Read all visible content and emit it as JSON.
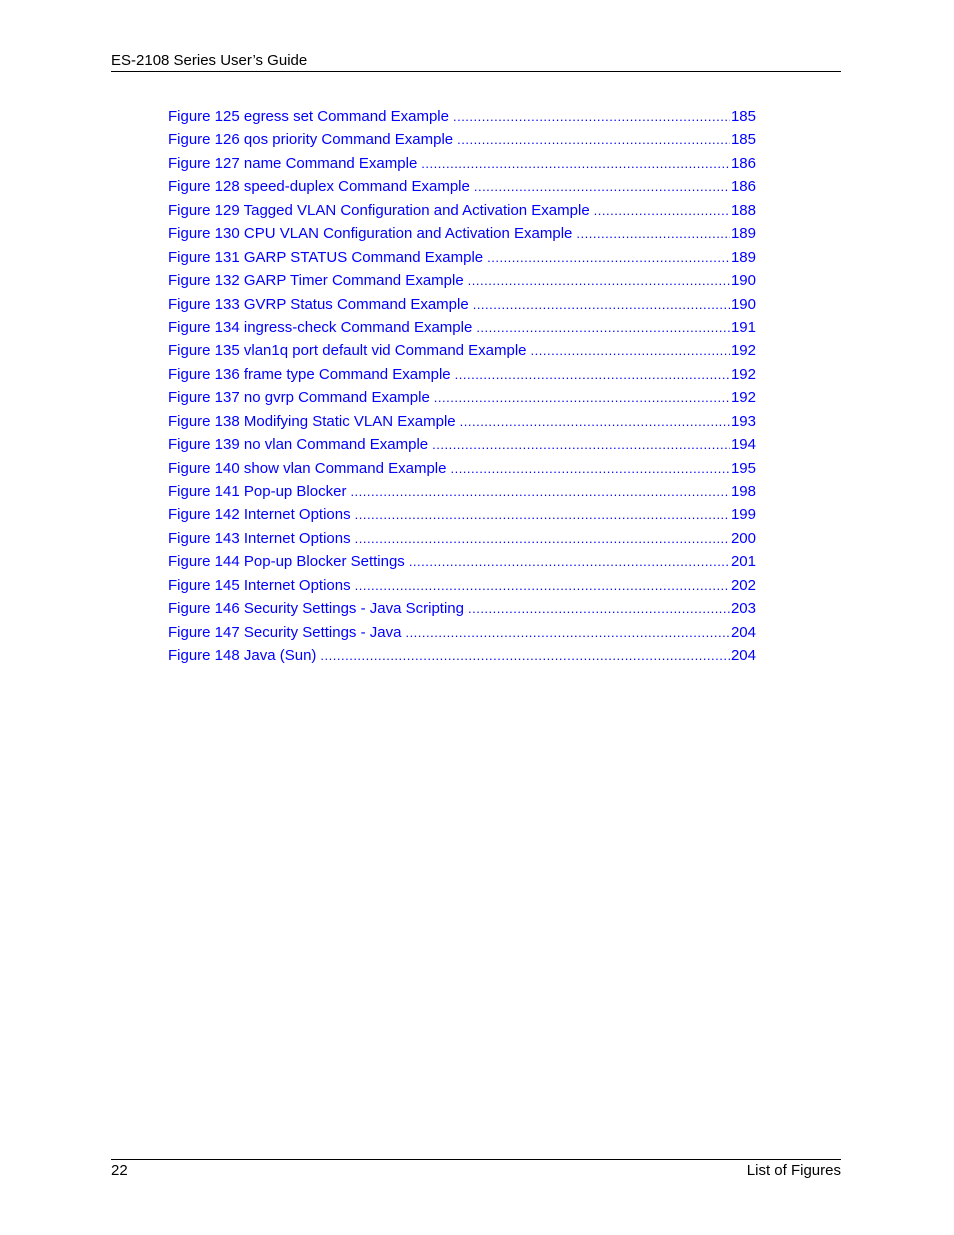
{
  "header": {
    "title": "ES-2108 Series User’s Guide"
  },
  "toc": {
    "link_color": "#0000ff",
    "entries": [
      {
        "title": "Figure 125 egress set Command Example",
        "page": "185"
      },
      {
        "title": "Figure 126 qos priority Command Example",
        "page": "185"
      },
      {
        "title": "Figure 127 name Command Example",
        "page": "186"
      },
      {
        "title": "Figure 128 speed-duplex Command Example",
        "page": "186"
      },
      {
        "title": "Figure 129 Tagged VLAN Configuration and Activation Example",
        "page": "188"
      },
      {
        "title": "Figure 130 CPU VLAN Configuration and Activation Example",
        "page": "189"
      },
      {
        "title": "Figure 131 GARP STATUS Command Example",
        "page": "189"
      },
      {
        "title": "Figure 132 GARP Timer Command Example",
        "page": "190"
      },
      {
        "title": "Figure 133 GVRP Status Command Example",
        "page": "190"
      },
      {
        "title": "Figure 134 ingress-check Command Example",
        "page": "191"
      },
      {
        "title": "Figure 135 vlan1q port default vid Command Example",
        "page": "192"
      },
      {
        "title": "Figure 136 frame type Command Example",
        "page": "192"
      },
      {
        "title": "Figure 137 no gvrp Command Example",
        "page": "192"
      },
      {
        "title": "Figure 138 Modifying Static VLAN Example",
        "page": "193"
      },
      {
        "title": "Figure 139 no vlan Command Example",
        "page": "194"
      },
      {
        "title": "Figure 140 show vlan Command Example",
        "page": "195"
      },
      {
        "title": "Figure 141 Pop-up Blocker",
        "page": "198"
      },
      {
        "title": "Figure 142  Internet Options",
        "page": "199"
      },
      {
        "title": "Figure 143 Internet Options",
        "page": "200"
      },
      {
        "title": "Figure 144 Pop-up Blocker Settings",
        "page": "201"
      },
      {
        "title": "Figure 145 Internet Options",
        "page": "202"
      },
      {
        "title": "Figure 146 Security Settings - Java Scripting",
        "page": "203"
      },
      {
        "title": "Figure 147 Security Settings - Java",
        "page": "204"
      },
      {
        "title": "Figure 148 Java (Sun)",
        "page": "204"
      }
    ]
  },
  "footer": {
    "page_number": "22",
    "section": "List of Figures"
  }
}
